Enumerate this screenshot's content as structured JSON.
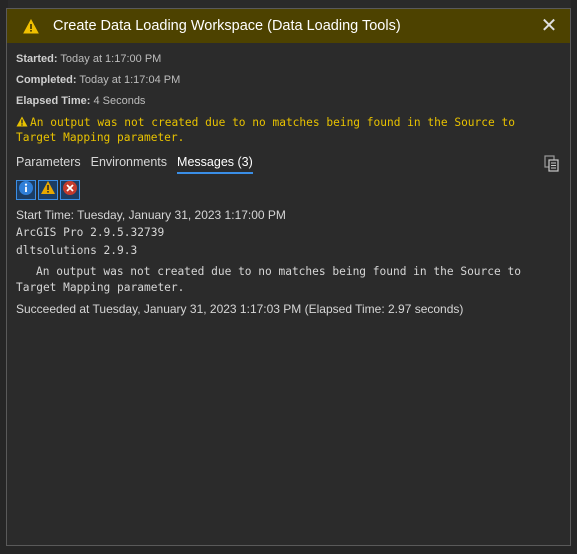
{
  "dialog": {
    "title": "Create Data Loading Workspace (Data Loading Tools)",
    "close_label": "✕"
  },
  "details": {
    "started_label": "Started:",
    "started_value": "Today at 1:17:00 PM",
    "completed_label": "Completed:",
    "completed_value": "Today at 1:17:04 PM",
    "elapsed_label": "Elapsed Time:",
    "elapsed_value": "4 Seconds"
  },
  "warning": {
    "text": "An output was not created due to no matches being found in the Source to Target Mapping parameter."
  },
  "tabs": [
    {
      "label": "Parameters"
    },
    {
      "label": "Environments"
    },
    {
      "label": "Messages (3)"
    }
  ],
  "filters": {
    "info_icon": "info-icon",
    "warning_icon": "warning-icon",
    "error_icon": "error-icon"
  },
  "messages": [
    "Start Time: Tuesday, January 31, 2023 1:17:00 PM",
    "ArcGIS Pro 2.9.5.32739",
    "dltsolutions 2.9.3",
    "An output was not created due to no matches being found in the Source to Target Mapping parameter.",
    "Succeeded at Tuesday, January 31, 2023 1:17:03 PM (Elapsed Time: 2.97 seconds)"
  ],
  "colors": {
    "title_bar": "#4d4200",
    "warning_text": "#e8c200",
    "accent": "#3a8ee6"
  }
}
